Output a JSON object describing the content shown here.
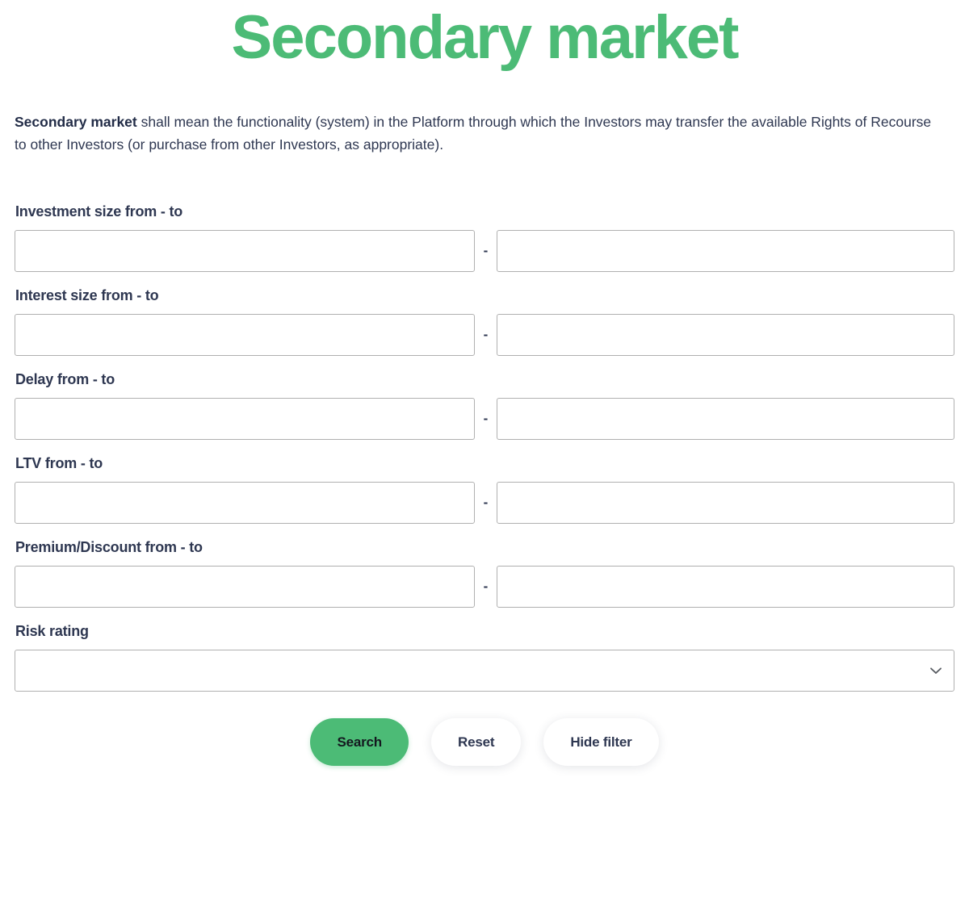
{
  "header": {
    "title": "Secondary market"
  },
  "intro": {
    "term": "Secondary market",
    "text": " shall mean the functionality (system) in the Platform through which the Investors may transfer the available Rights of Recourse to other Investors (or purchase from other Investors, as appropriate)."
  },
  "form": {
    "range_separator": "-",
    "fields": [
      {
        "label": "Investment size from - to",
        "name": "investment-size",
        "from_value": "",
        "from_placeholder": "",
        "to_value": "",
        "to_placeholder": ""
      },
      {
        "label": "Interest size from - to",
        "name": "interest-size",
        "from_value": "",
        "from_placeholder": "",
        "to_value": "",
        "to_placeholder": ""
      },
      {
        "label": "Delay from - to",
        "name": "delay",
        "from_value": "",
        "from_placeholder": "",
        "to_value": "",
        "to_placeholder": ""
      },
      {
        "label": "LTV from - to",
        "name": "ltv",
        "from_value": "",
        "from_placeholder": "",
        "to_value": "",
        "to_placeholder": ""
      },
      {
        "label": "Premium/Discount from - to",
        "name": "premium-discount",
        "from_value": "",
        "from_placeholder": "",
        "to_value": "",
        "to_placeholder": ""
      }
    ],
    "risk_rating": {
      "label": "Risk rating",
      "selected_value": "",
      "chevron_icon": "chevron-down-icon"
    }
  },
  "buttons": {
    "search": "Search",
    "reset": "Reset",
    "hide_filter": "Hide filter"
  },
  "colors": {
    "accent_green": "#4cbb76",
    "text_navy": "#2e3751",
    "input_border": "#b0b0b0",
    "page_background": "#ffffff"
  }
}
